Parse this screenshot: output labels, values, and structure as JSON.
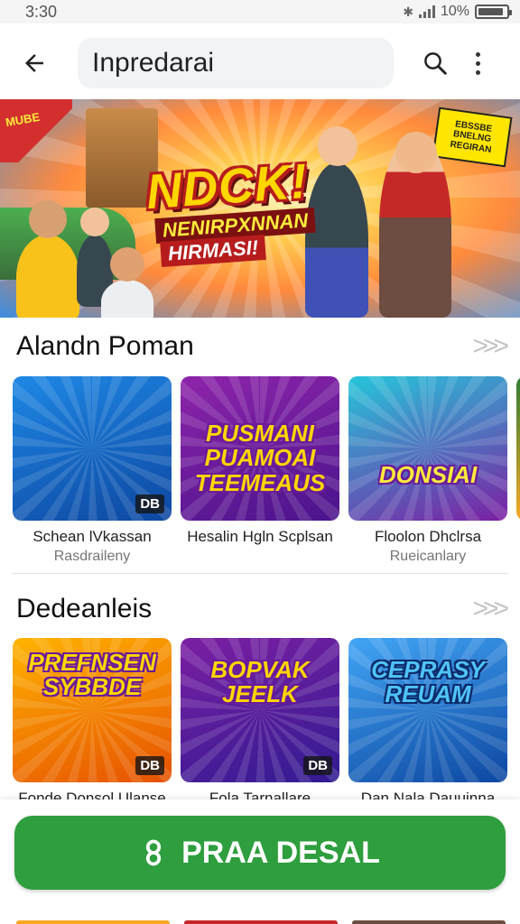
{
  "status_bar": {
    "time": "3:30",
    "battery": "10%",
    "battery_level": 0.9
  },
  "app_bar": {
    "search_value": "Inpredarai",
    "icons": [
      "back-arrow-icon",
      "search-icon",
      "more-vert-icon"
    ]
  },
  "hero": {
    "title": "NDCK!",
    "subtitle_line1": "NENIRPXNNAN",
    "subtitle_line2": "HIRMASI!",
    "corner_badge": "MUBE",
    "tag_text": "EBSSBE BNELNG REGIRAN"
  },
  "sections": [
    {
      "title": "Alandn Poman",
      "cards": [
        {
          "art_title": "",
          "badge": "DB",
          "title": "Schean lVkassan",
          "subtitle": "Rasdraileny",
          "colors": [
            "#1e88e5",
            "#0d47a1"
          ]
        },
        {
          "art_title": "PUSMANI PUAMOAI TEEMEAUS",
          "badge": "",
          "title": "Hesalin Hgln Scplsan",
          "subtitle": "",
          "colors": [
            "#8e24aa",
            "#4a148c"
          ]
        },
        {
          "art_title": "DONSIAI",
          "badge": "",
          "title": "Floolon Dhclrsa",
          "subtitle": "Rueicanlary",
          "colors": [
            "#26c6da",
            "#7b1fa2"
          ]
        }
      ]
    },
    {
      "title": "Dedeanleis",
      "cards": [
        {
          "art_title": "PREFNSEN SYBBDE",
          "badge": "DB",
          "title": "Fonde Donsol Ulanse",
          "subtitle": "",
          "colors": [
            "#ffb300",
            "#e65100"
          ]
        },
        {
          "art_title": "BOPVAK JEELK",
          "badge": "DB",
          "title": "Fola Tarnallare",
          "subtitle": "",
          "colors": [
            "#7b1fa2",
            "#311b92"
          ]
        },
        {
          "art_title": "CEPRASY REUAM",
          "badge": "",
          "title": "Dan Nala Dauuinna",
          "subtitle": "",
          "colors": [
            "#42a5f5",
            "#0d47a1"
          ]
        }
      ]
    }
  ],
  "install_button": {
    "label": "PRAA DESAL",
    "icon": "install-glyph-icon",
    "color": "#2e9e3e"
  }
}
